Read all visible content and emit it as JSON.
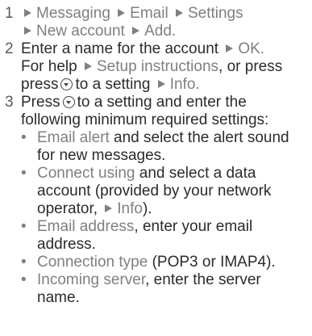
{
  "steps": [
    {
      "number": "1",
      "path": [
        "Messaging",
        "Email",
        "Settings",
        "New account",
        "Add."
      ]
    },
    {
      "number": "2",
      "text_a": "Enter a name for the account",
      "ok_label": "OK.",
      "text_b": "For help",
      "setup_label": "Setup instructions",
      "text_c": ", or press",
      "text_d": "to a setting",
      "info_label": "Info."
    },
    {
      "number": "3",
      "text_a": "Press",
      "text_b": "to a setting and enter the following minimum required settings:",
      "bullets": [
        {
          "term": "Email alert",
          "rest": " and select the alert sound for new messages."
        },
        {
          "term": "Connect using",
          "rest": " and select a data account (provided by your network operator, ",
          "info_label": "Info",
          "rest_end": ")."
        },
        {
          "term": "Email address",
          "rest": ", enter your email address."
        },
        {
          "term": "Connection type",
          "rest": " (POP3 or IMAP4)."
        },
        {
          "term": "Incoming server",
          "rest": ", enter the server name."
        }
      ]
    }
  ],
  "colors": {
    "text": "#2b2b2b",
    "menu": "#7f7f7f"
  },
  "icons": {
    "arrow": "triangle-right-icon",
    "navigation_key": "joystick-down-icon",
    "bullet": "bullet-icon"
  }
}
